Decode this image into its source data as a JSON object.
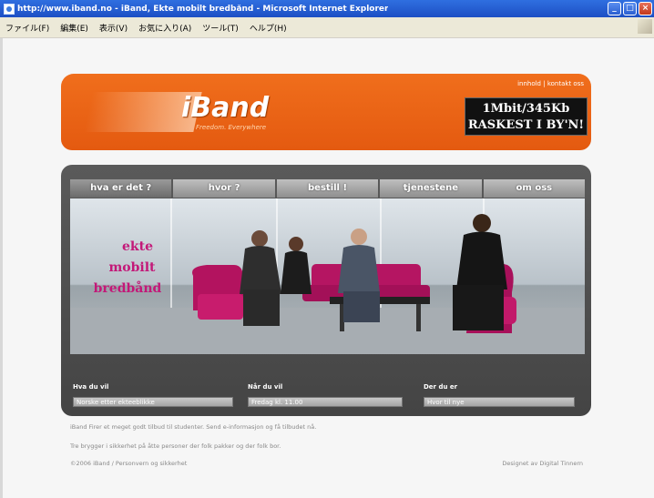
{
  "window": {
    "title": "http://www.iband.no - iBand, Ekte mobilt bredbånd - Microsoft Internet Explorer",
    "controls": [
      "_",
      "□",
      "×"
    ]
  },
  "menu": {
    "items": [
      "ファイル(F)",
      "編集(E)",
      "表示(V)",
      "お気に入り(A)",
      "ツール(T)",
      "ヘルプ(H)"
    ]
  },
  "header": {
    "brand": "iBand",
    "slogan": "Freedom. Everywhere",
    "links": [
      "innhold",
      "kontakt oss"
    ],
    "link_separator": "|",
    "promo_line1": "1Mbit/345Kb",
    "promo_line2": "RASKEST I BY'N!"
  },
  "nav": {
    "tabs": [
      "hva er det ?",
      "hvor ?",
      "bestill !",
      "tjenestene",
      "om oss"
    ]
  },
  "hero": {
    "slogans": [
      "ekte",
      "mobilt",
      "bredbånd"
    ]
  },
  "fields": [
    {
      "label": "Hva du vil",
      "value": "Norske etter ekteeblikke"
    },
    {
      "label": "Når du vil",
      "value": "Fredag kl. 11.00"
    },
    {
      "label": "Der du er",
      "value": "Hvor til nye"
    }
  ],
  "footer": {
    "line1": "iBand Firer et meget godt tilbud til studenter. Send e-informasjon og få tilbudet nå.",
    "line2": "Tre brygger i sikkerhet på åtte personer der folk pakker og der folk bor.",
    "line3": "©2006 iBand / Personvern og sikkerhet",
    "credit": "Designet av Digital Tinnern"
  }
}
